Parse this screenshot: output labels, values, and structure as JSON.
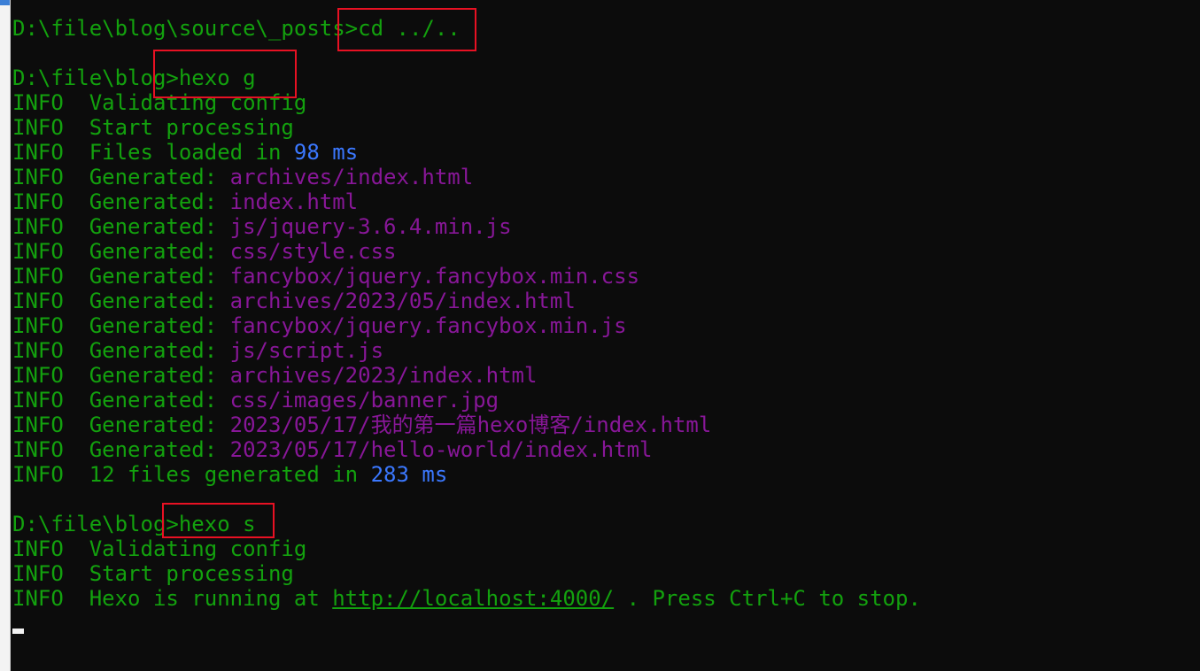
{
  "terminal": {
    "colors": {
      "background": "#0c0c0c",
      "green": "#13a10e",
      "purple": "#881798",
      "blue": "#3b78ff",
      "highlight_box": "#e81123"
    },
    "lines": [
      {
        "name": "prompt-cd",
        "segments": [
          {
            "text": "D:\\file\\blog\\source\\_posts>",
            "style": "g"
          },
          {
            "text": "cd ../..",
            "style": "g"
          }
        ]
      },
      {
        "name": "blank-line-1",
        "segments": [
          {
            "text": " ",
            "style": "g"
          }
        ]
      },
      {
        "name": "prompt-hexo-g",
        "segments": [
          {
            "text": "D:\\file\\blog>",
            "style": "g"
          },
          {
            "text": "hexo g",
            "style": "g"
          }
        ]
      },
      {
        "name": "log-line",
        "segments": [
          {
            "text": "INFO  Validating config",
            "style": "g"
          }
        ]
      },
      {
        "name": "log-line",
        "segments": [
          {
            "text": "INFO  Start processing",
            "style": "g"
          }
        ]
      },
      {
        "name": "log-line",
        "segments": [
          {
            "text": "INFO  Files loaded in ",
            "style": "g"
          },
          {
            "text": "98 ms",
            "style": "b"
          }
        ]
      },
      {
        "name": "log-line",
        "segments": [
          {
            "text": "INFO  Generated: ",
            "style": "g"
          },
          {
            "text": "archives/index.html",
            "style": "p"
          }
        ]
      },
      {
        "name": "log-line",
        "segments": [
          {
            "text": "INFO  Generated: ",
            "style": "g"
          },
          {
            "text": "index.html",
            "style": "p"
          }
        ]
      },
      {
        "name": "log-line",
        "segments": [
          {
            "text": "INFO  Generated: ",
            "style": "g"
          },
          {
            "text": "js/jquery-3.6.4.min.js",
            "style": "p"
          }
        ]
      },
      {
        "name": "log-line",
        "segments": [
          {
            "text": "INFO  Generated: ",
            "style": "g"
          },
          {
            "text": "css/style.css",
            "style": "p"
          }
        ]
      },
      {
        "name": "log-line",
        "segments": [
          {
            "text": "INFO  Generated: ",
            "style": "g"
          },
          {
            "text": "fancybox/jquery.fancybox.min.css",
            "style": "p"
          }
        ]
      },
      {
        "name": "log-line",
        "segments": [
          {
            "text": "INFO  Generated: ",
            "style": "g"
          },
          {
            "text": "archives/2023/05/index.html",
            "style": "p"
          }
        ]
      },
      {
        "name": "log-line",
        "segments": [
          {
            "text": "INFO  Generated: ",
            "style": "g"
          },
          {
            "text": "fancybox/jquery.fancybox.min.js",
            "style": "p"
          }
        ]
      },
      {
        "name": "log-line",
        "segments": [
          {
            "text": "INFO  Generated: ",
            "style": "g"
          },
          {
            "text": "js/script.js",
            "style": "p"
          }
        ]
      },
      {
        "name": "log-line",
        "segments": [
          {
            "text": "INFO  Generated: ",
            "style": "g"
          },
          {
            "text": "archives/2023/index.html",
            "style": "p"
          }
        ]
      },
      {
        "name": "log-line",
        "segments": [
          {
            "text": "INFO  Generated: ",
            "style": "g"
          },
          {
            "text": "css/images/banner.jpg",
            "style": "p"
          }
        ]
      },
      {
        "name": "log-line",
        "segments": [
          {
            "text": "INFO  Generated: ",
            "style": "g"
          },
          {
            "text": "2023/05/17/我的第一篇hexo博客/index.html",
            "style": "p"
          }
        ]
      },
      {
        "name": "log-line",
        "segments": [
          {
            "text": "INFO  Generated: ",
            "style": "g"
          },
          {
            "text": "2023/05/17/hello-world/index.html",
            "style": "p"
          }
        ]
      },
      {
        "name": "log-line",
        "segments": [
          {
            "text": "INFO  12 files generated in ",
            "style": "g"
          },
          {
            "text": "283 ms",
            "style": "b"
          }
        ]
      },
      {
        "name": "blank-line-2",
        "segments": [
          {
            "text": " ",
            "style": "g"
          }
        ]
      },
      {
        "name": "prompt-hexo-s",
        "segments": [
          {
            "text": "D:\\file\\blog>",
            "style": "g"
          },
          {
            "text": "hexo s",
            "style": "g"
          }
        ]
      },
      {
        "name": "log-line",
        "segments": [
          {
            "text": "INFO  Validating config",
            "style": "g"
          }
        ]
      },
      {
        "name": "log-line",
        "segments": [
          {
            "text": "INFO  Start processing",
            "style": "g"
          }
        ]
      },
      {
        "name": "log-line",
        "segments": [
          {
            "text": "INFO  Hexo is running at ",
            "style": "g"
          },
          {
            "text": "http://localhost:4000/",
            "style": "u",
            "link": true
          },
          {
            "text": " . Press Ctrl+C to stop.",
            "style": "g"
          }
        ]
      }
    ]
  }
}
